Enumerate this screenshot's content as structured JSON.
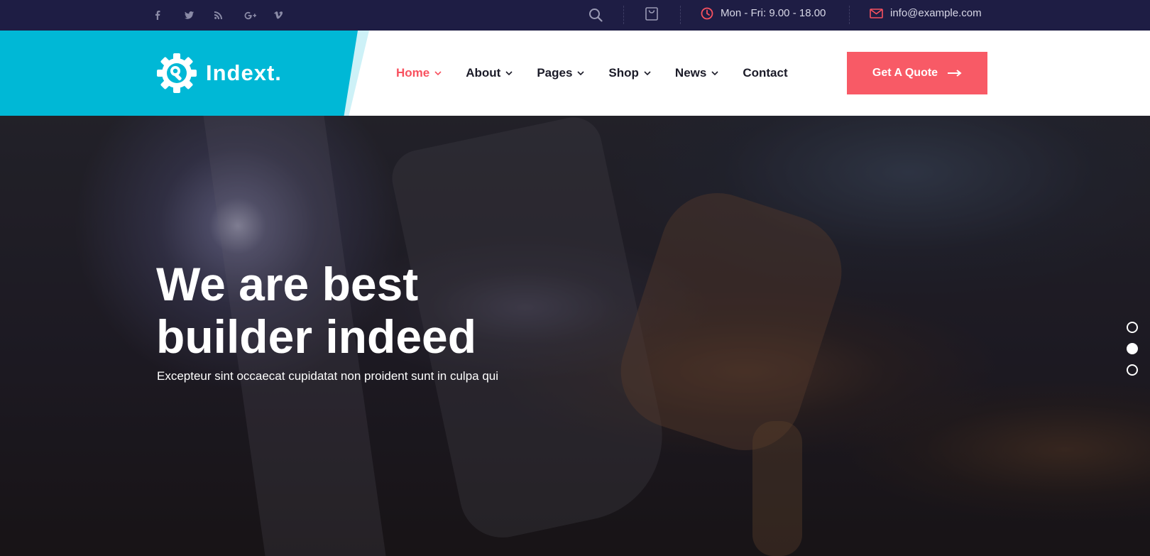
{
  "topbar": {
    "social": [
      {
        "name": "facebook-icon",
        "glyph": "f"
      },
      {
        "name": "twitter-icon",
        "glyph": "t"
      },
      {
        "name": "rss-icon",
        "glyph": "rss"
      },
      {
        "name": "google-plus-icon",
        "glyph": "G+"
      },
      {
        "name": "vimeo-icon",
        "glyph": "v"
      }
    ],
    "hours": "Mon - Fri: 9.00 - 18.00",
    "email": "info@example.com"
  },
  "logo": {
    "text": "Indext."
  },
  "nav": {
    "items": [
      {
        "label": "Home",
        "active": true,
        "has_dropdown": true
      },
      {
        "label": "About",
        "active": false,
        "has_dropdown": true
      },
      {
        "label": "Pages",
        "active": false,
        "has_dropdown": true
      },
      {
        "label": "Shop",
        "active": false,
        "has_dropdown": true
      },
      {
        "label": "News",
        "active": false,
        "has_dropdown": true
      },
      {
        "label": "Contact",
        "active": false,
        "has_dropdown": false
      }
    ]
  },
  "cta": {
    "label": "Get A Quote"
  },
  "hero": {
    "title_line1": "We are best",
    "title_line2": "builder indeed",
    "subtitle": "Excepteur sint occaecat cupidatat non proident sunt in culpa qui",
    "slides": 3,
    "active_slide": 2
  },
  "colors": {
    "topbar": "#1e1d44",
    "brand_cyan": "#00b8d6",
    "accent": "#f8515f",
    "nav_text": "#1b1b28"
  }
}
